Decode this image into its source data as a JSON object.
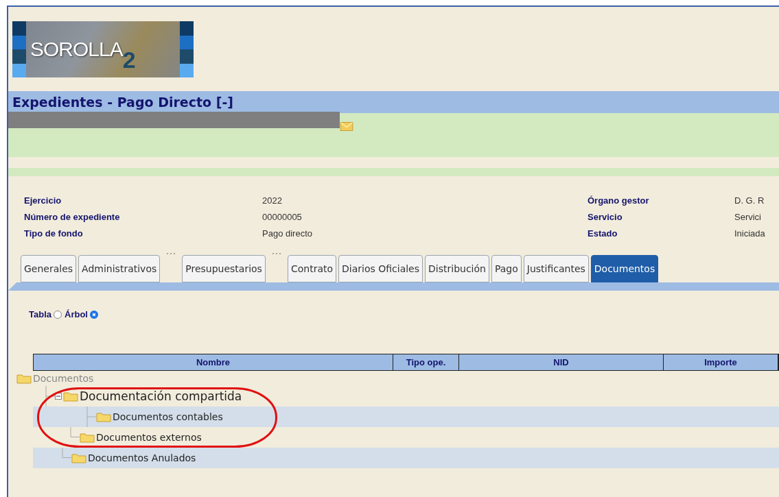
{
  "logo": {
    "text": "SOROLLA",
    "suffix": "2"
  },
  "title": "Expedientes - Pago Directo [-]",
  "fields_left": [
    {
      "label": "Ejercicio",
      "value": "2022"
    },
    {
      "label": "Número de expediente",
      "value": "00000005"
    },
    {
      "label": "Tipo de fondo",
      "value": "Pago directo"
    }
  ],
  "fields_right": [
    {
      "label": "Órgano gestor",
      "value": "D. G. R"
    },
    {
      "label": "Servicio",
      "value": "Servici"
    },
    {
      "label": "Estado",
      "value": "Iniciada"
    }
  ],
  "tabs": [
    {
      "label": "Generales",
      "selected": false,
      "gap_after": false
    },
    {
      "label": "Administrativos",
      "selected": false,
      "gap_after": true
    },
    {
      "label": "Presupuestarios",
      "selected": false,
      "gap_after": true
    },
    {
      "label": "Contrato",
      "selected": false,
      "gap_after": false
    },
    {
      "label": "Diarios Oficiales",
      "selected": false,
      "gap_after": false
    },
    {
      "label": "Distribución",
      "selected": false,
      "gap_after": false
    },
    {
      "label": "Pago",
      "selected": false,
      "gap_after": false
    },
    {
      "label": "Justificantes",
      "selected": false,
      "gap_after": false
    },
    {
      "label": "Documentos",
      "selected": true,
      "gap_after": false
    }
  ],
  "view_options": [
    {
      "label": "Tabla",
      "selected": false
    },
    {
      "label": "Árbol",
      "selected": true
    }
  ],
  "table": {
    "columns": [
      "Nombre",
      "Tipo ope.",
      "NID",
      "Importe"
    ]
  },
  "tree": [
    {
      "label": "Documentos",
      "disabled": true,
      "selected": false,
      "children": [
        {
          "label": "Documentación compartida",
          "disabled": false,
          "selected": true,
          "expanded": true,
          "children": [
            {
              "label": "Documentos contables",
              "disabled": false,
              "selected": false
            },
            {
              "label": "Documentos externos",
              "disabled": false,
              "selected": false
            }
          ]
        },
        {
          "label": "Documentos Anulados",
          "disabled": false,
          "selected": false
        }
      ]
    }
  ],
  "annotation": {
    "kind": "ellipse"
  }
}
